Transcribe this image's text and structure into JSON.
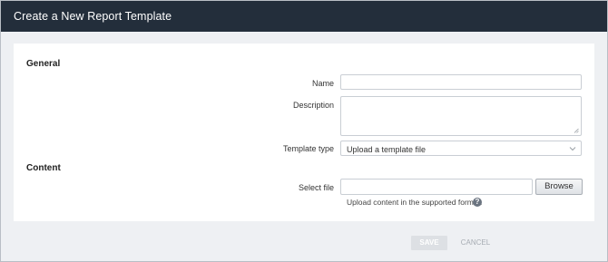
{
  "dialog": {
    "title": "Create a New Report Template"
  },
  "general": {
    "heading": "General",
    "name_label": "Name",
    "name_value": "",
    "description_label": "Description",
    "description_value": "",
    "template_type_label": "Template type",
    "template_type_selected": "Upload a template file"
  },
  "content": {
    "heading": "Content",
    "select_file_label": "Select file",
    "file_value": "",
    "browse_label": "Browse",
    "hint": "Upload content in the supported format.",
    "help_glyph": "?"
  },
  "footer": {
    "save_label": "SAVE",
    "cancel_label": "CANCEL"
  },
  "icons": {
    "chevron": "chevron-down-icon",
    "help": "help-icon",
    "resize": "resize-handle-icon"
  }
}
